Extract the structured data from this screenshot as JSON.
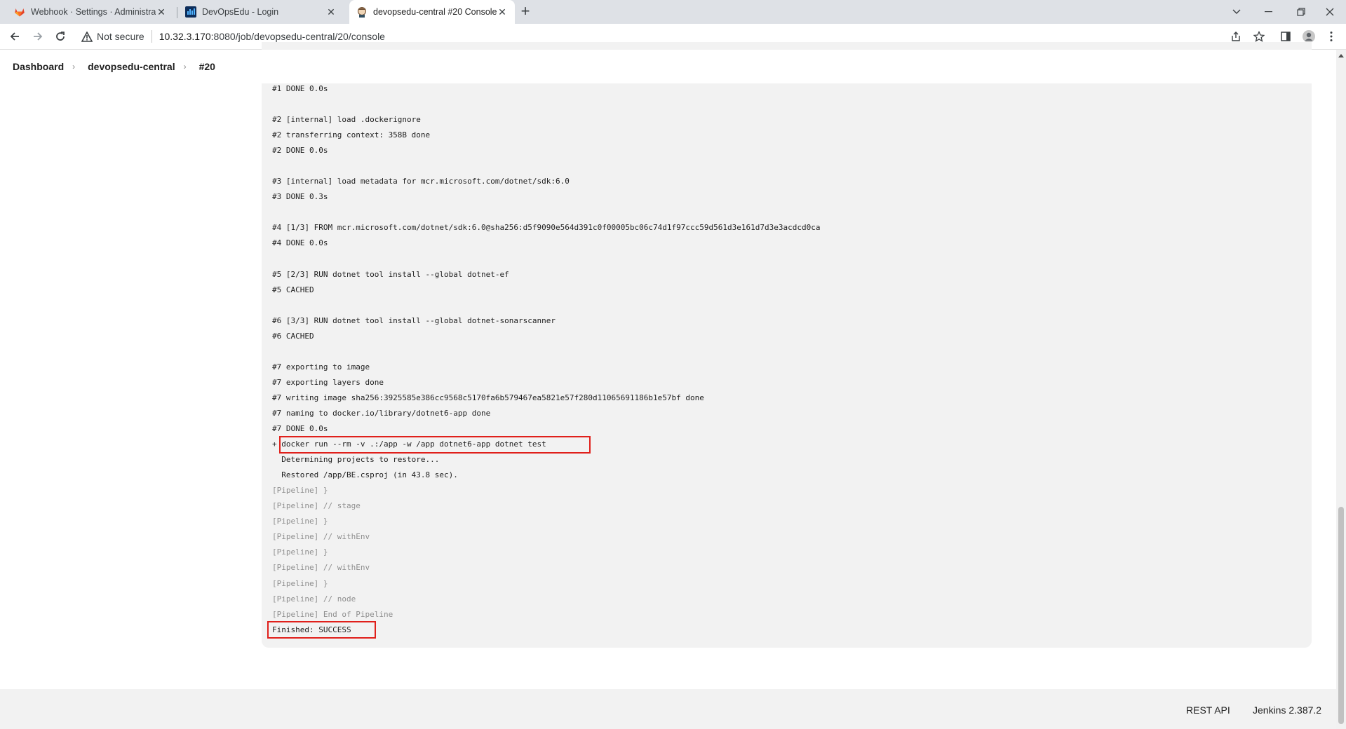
{
  "browser": {
    "tabs": [
      {
        "title": "Webhook · Settings · Administrat",
        "close": "✕"
      },
      {
        "title": "DevOpsEdu - Login",
        "close": "✕"
      },
      {
        "title": "devopsedu-central #20 Console [",
        "close": "✕"
      }
    ],
    "new_tab": "+",
    "window_controls": {
      "list": "⌄",
      "minimize": "—",
      "restore": "❐",
      "close": "✕"
    },
    "address": {
      "security_label": "Not secure",
      "url_host": "10.32.3.170",
      "url_rest": ":8080/job/devopsedu-central/20/console"
    },
    "icons": [
      "back-arrow-icon",
      "forward-arrow-icon",
      "reload-icon",
      "warning-icon",
      "share-icon",
      "star-icon",
      "side-panel-icon",
      "profile-icon",
      "kebab-menu-icon"
    ]
  },
  "breadcrumb": {
    "items": [
      "Dashboard",
      "devopsedu-central",
      "#20"
    ],
    "separator": "›"
  },
  "console": {
    "lines": [
      {
        "text": "#1 DONE 0.0s",
        "kind": "normal"
      },
      {
        "text": "",
        "kind": "normal"
      },
      {
        "text": "#2 [internal] load .dockerignore",
        "kind": "normal"
      },
      {
        "text": "#2 transferring context: 358B done",
        "kind": "normal"
      },
      {
        "text": "#2 DONE 0.0s",
        "kind": "normal"
      },
      {
        "text": "",
        "kind": "normal"
      },
      {
        "text": "#3 [internal] load metadata for mcr.microsoft.com/dotnet/sdk:6.0",
        "kind": "normal"
      },
      {
        "text": "#3 DONE 0.3s",
        "kind": "normal"
      },
      {
        "text": "",
        "kind": "normal"
      },
      {
        "text": "#4 [1/3] FROM mcr.microsoft.com/dotnet/sdk:6.0@sha256:d5f9090e564d391c0f00005bc06c74d1f97ccc59d561d3e161d7d3e3acdcd0ca",
        "kind": "normal"
      },
      {
        "text": "#4 DONE 0.0s",
        "kind": "normal"
      },
      {
        "text": "",
        "kind": "normal"
      },
      {
        "text": "#5 [2/3] RUN dotnet tool install --global dotnet-ef",
        "kind": "normal"
      },
      {
        "text": "#5 CACHED",
        "kind": "normal"
      },
      {
        "text": "",
        "kind": "normal"
      },
      {
        "text": "#6 [3/3] RUN dotnet tool install --global dotnet-sonarscanner",
        "kind": "normal"
      },
      {
        "text": "#6 CACHED",
        "kind": "normal"
      },
      {
        "text": "",
        "kind": "normal"
      },
      {
        "text": "#7 exporting to image",
        "kind": "normal"
      },
      {
        "text": "#7 exporting layers done",
        "kind": "normal"
      },
      {
        "text": "#7 writing image sha256:3925585e386cc9568c5170fa6b579467ea5821e57f280d11065691186b1e57bf done",
        "kind": "normal"
      },
      {
        "text": "#7 naming to docker.io/library/dotnet6-app done",
        "kind": "normal"
      },
      {
        "text": "#7 DONE 0.0s",
        "kind": "normal"
      },
      {
        "text": "+ docker run --rm -v .:/app -w /app dotnet6-app dotnet test",
        "kind": "normal"
      },
      {
        "text": "  Determining projects to restore...",
        "kind": "normal"
      },
      {
        "text": "  Restored /app/BE.csproj (in 43.8 sec).",
        "kind": "normal"
      },
      {
        "text": "[Pipeline] }",
        "kind": "pipeline"
      },
      {
        "text": "[Pipeline] // stage",
        "kind": "pipeline"
      },
      {
        "text": "[Pipeline] }",
        "kind": "pipeline"
      },
      {
        "text": "[Pipeline] // withEnv",
        "kind": "pipeline"
      },
      {
        "text": "[Pipeline] }",
        "kind": "pipeline"
      },
      {
        "text": "[Pipeline] // withEnv",
        "kind": "pipeline"
      },
      {
        "text": "[Pipeline] }",
        "kind": "pipeline"
      },
      {
        "text": "[Pipeline] // node",
        "kind": "pipeline"
      },
      {
        "text": "[Pipeline] End of Pipeline",
        "kind": "pipeline"
      },
      {
        "text": "Finished: SUCCESS",
        "kind": "normal"
      }
    ]
  },
  "footer": {
    "rest_api": "REST API",
    "version": "Jenkins 2.387.2"
  },
  "colors": {
    "highlight": "#e0201b",
    "console_bg": "#f2f2f2",
    "pipeline_text": "#8f8f8f"
  }
}
